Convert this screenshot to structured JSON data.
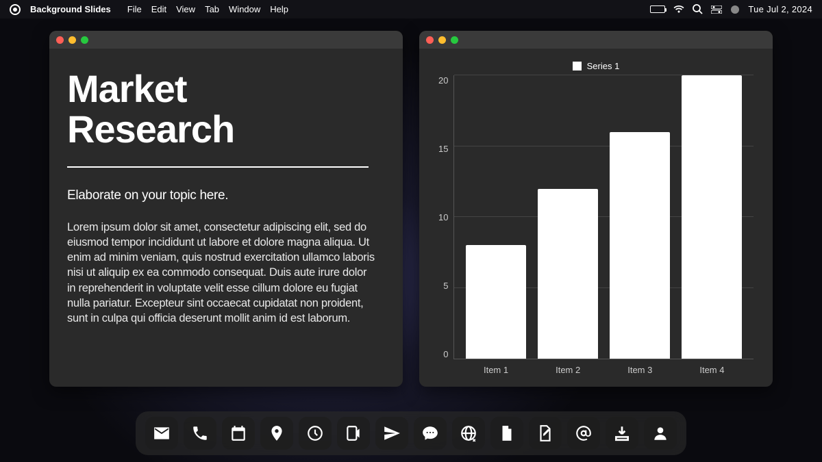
{
  "menubar": {
    "app_name": "Background Slides",
    "menus": [
      "File",
      "Edit",
      "View",
      "Tab",
      "Window",
      "Help"
    ],
    "date": "Tue  Jul 2,  2024"
  },
  "left_panel": {
    "title_line1": "Market",
    "title_line2": "Research",
    "subtitle": "Elaborate on your topic here.",
    "body": "Lorem ipsum dolor sit amet, consectetur adipiscing elit, sed do eiusmod tempor incididunt ut labore et dolore magna aliqua. Ut enim ad minim veniam, quis nostrud exercitation ullamco laboris nisi ut aliquip ex ea commodo consequat. Duis aute irure dolor in reprehenderit in voluptate velit esse cillum dolore eu fugiat nulla pariatur. Excepteur sint occaecat cupidatat non proident, sunt in culpa qui officia deserunt mollit anim id est laborum."
  },
  "chart_data": {
    "type": "bar",
    "legend": "Series 1",
    "categories": [
      "Item 1",
      "Item 2",
      "Item 3",
      "Item 4"
    ],
    "values": [
      8,
      12,
      16,
      20
    ],
    "ylim": [
      0,
      20
    ],
    "yticks": [
      0,
      5,
      10,
      15,
      20
    ]
  },
  "dock": {
    "icons": [
      "mail",
      "phone",
      "calendar",
      "location",
      "clock",
      "share-device",
      "send",
      "chat",
      "globe",
      "document",
      "edit-document",
      "at-sign",
      "download",
      "user"
    ]
  }
}
